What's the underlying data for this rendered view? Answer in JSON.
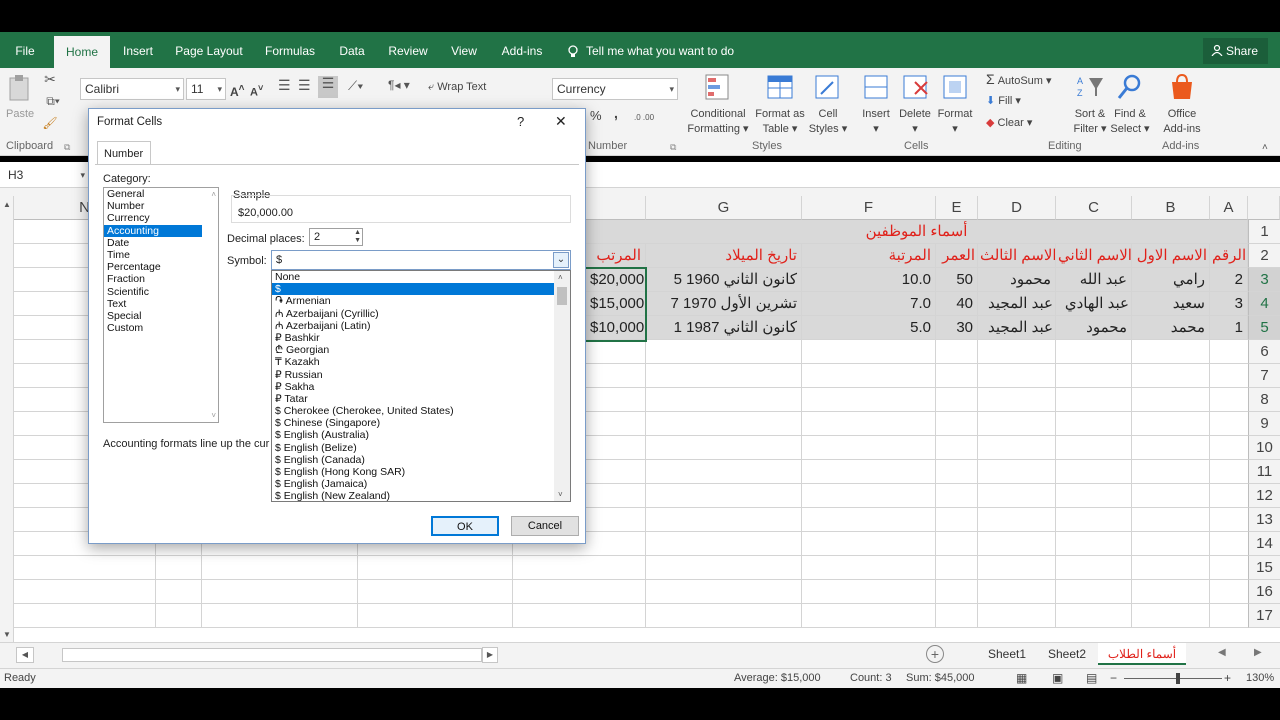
{
  "ribbon": {
    "tabs": [
      "File",
      "Home",
      "Insert",
      "Page Layout",
      "Formulas",
      "Data",
      "Review",
      "View",
      "Add-ins"
    ],
    "active_tab": "Home",
    "tell_me": "Tell me what you want to do",
    "share": "Share",
    "paste": "Paste",
    "font_name": "Calibri",
    "font_size": "11",
    "wrap_text": "Wrap Text",
    "number_format": "Currency",
    "percent": "%",
    "comma": ",",
    "cond_format": [
      "Conditional",
      "Formatting"
    ],
    "format_table": [
      "Format as",
      "Table"
    ],
    "cell_styles": [
      "Cell",
      "Styles"
    ],
    "insert": "Insert",
    "delete": "Delete",
    "format": "Format",
    "autosum": "AutoSum",
    "fill": "Fill",
    "clear": "Clear",
    "sort_filter": [
      "Sort &",
      "Filter"
    ],
    "find_select": [
      "Find &",
      "Select"
    ],
    "office_addins": [
      "Office",
      "Add-ins"
    ],
    "groups": {
      "clipboard": "Clipboard",
      "number": "Number",
      "styles": "Styles",
      "cells": "Cells",
      "editing": "Editing",
      "addins": "Add-ins"
    }
  },
  "formula_bar": {
    "name_box": "H3"
  },
  "grid": {
    "columns": [
      "N",
      "G",
      "F",
      "E",
      "D",
      "C",
      "B",
      "A"
    ],
    "rows": [
      "1",
      "2",
      "3",
      "4",
      "5",
      "6",
      "7",
      "8",
      "9",
      "10",
      "11",
      "12",
      "13",
      "14",
      "15",
      "16",
      "17"
    ],
    "title": "أسماء الموظفين",
    "headers": {
      "salary": "المرتب",
      "birth": "تاريخ الميلاد",
      "rank": "المرتبة",
      "age": "العمر",
      "third": "الاسم الثالث",
      "second": "الاسم الثاني",
      "first": "الاسم الاول",
      "num": "الرقم"
    },
    "rows_data": [
      {
        "salary": "$20,000",
        "birth": "5 كانون الثاني 1960",
        "rank": "10.0",
        "age": "50",
        "third": "محمود",
        "second": "عبد الله",
        "first": "رامي",
        "num": "2"
      },
      {
        "salary": "$15,000",
        "birth": "7 تشرين الأول 1970",
        "rank": "7.0",
        "age": "40",
        "third": "عبد المجيد",
        "second": "عبد الهادي",
        "first": "سعيد",
        "num": "3"
      },
      {
        "salary": "$10,000",
        "birth": "1 كانون الثاني 1987",
        "rank": "5.0",
        "age": "30",
        "third": "عبد المجيد",
        "second": "محمود",
        "first": "محمد",
        "num": "1"
      }
    ]
  },
  "sheets": [
    "Sheet1",
    "Sheet2",
    "أسماء الطلاب"
  ],
  "status": {
    "ready": "Ready",
    "average": "Average: $15,000",
    "count": "Count: 3",
    "sum": "Sum: $45,000",
    "zoom": "130%"
  },
  "dialog": {
    "title": "Format Cells",
    "help": "?",
    "close": "✕",
    "tab": "Number",
    "category_label": "Category:",
    "categories": [
      "General",
      "Number",
      "Currency",
      "Accounting",
      "Date",
      "Time",
      "Percentage",
      "Fraction",
      "Scientific",
      "Text",
      "Special",
      "Custom"
    ],
    "selected_category": "Accounting",
    "sample_label": "Sample",
    "sample_value": "$20,000.00",
    "decimal_label": "Decimal places:",
    "decimal_value": "2",
    "symbol_label": "Symbol:",
    "symbol_value": "$",
    "symbols": [
      "None",
      "$",
      "֏ Armenian",
      "₼ Azerbaijani (Cyrillic)",
      "₼ Azerbaijani (Latin)",
      "₽ Bashkir",
      "₾ Georgian",
      "₸ Kazakh",
      "₽ Russian",
      "₽ Sakha",
      "₽ Tatar",
      "$ Cherokee (Cherokee, United States)",
      "$ Chinese (Singapore)",
      "$ English (Australia)",
      "$ English (Belize)",
      "$ English (Canada)",
      "$ English (Hong Kong SAR)",
      "$ English (Jamaica)",
      "$ English (New Zealand)"
    ],
    "selected_symbol": "$",
    "description": "Accounting formats line up the cur",
    "ok": "OK",
    "cancel": "Cancel"
  },
  "colors": {
    "excel_green": "#217346",
    "selection": "#0078d7",
    "red_text": "#e0211a"
  }
}
